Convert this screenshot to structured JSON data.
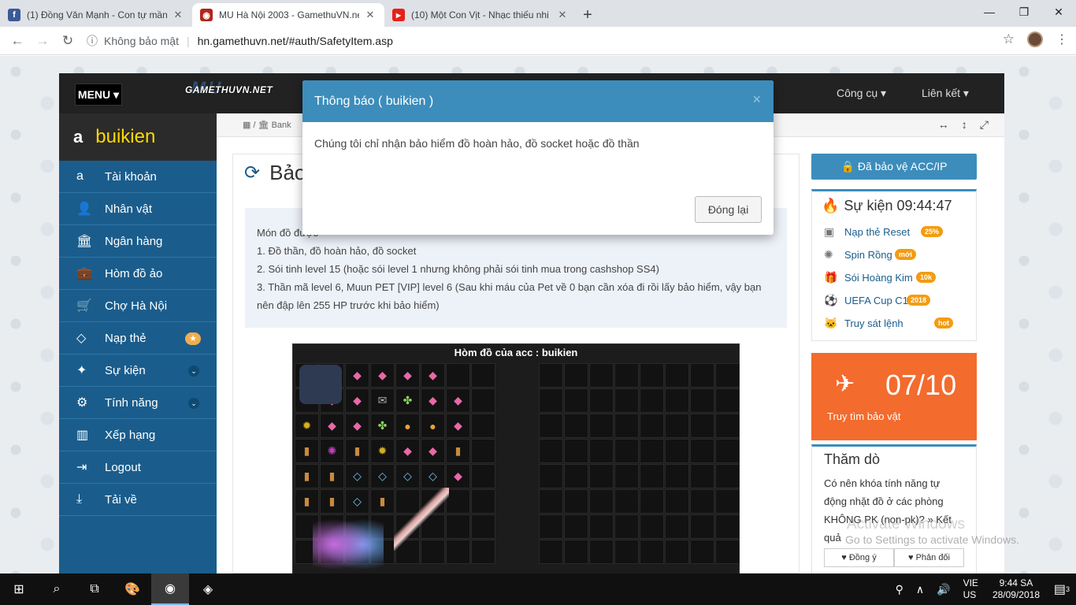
{
  "browser": {
    "tabs": [
      {
        "title": "(1) Đồng Văn Mạnh - Con tự mần",
        "icon": "facebook-icon",
        "color": "#3b5998",
        "glyph": "f"
      },
      {
        "title": "MU Hà Nội 2003 - GamethuVN.net",
        "icon": "mu-game-icon",
        "color": "#b0261c",
        "glyph": "◉"
      },
      {
        "title": "(10) Một Con Vịt - Nhạc thiếu nhi",
        "icon": "youtube-icon",
        "color": "#e62117",
        "glyph": "▶"
      }
    ],
    "security": "Không bảo mật",
    "url": "hn.gamethuvn.net/#auth/SafetyItem.asp"
  },
  "site": {
    "menu_label": "MENU ▾",
    "logo_back": "MU",
    "logo_text": "GAMETHUVN.NET",
    "nav_tools": "Công cụ ▾",
    "nav_links": "Liên kết ▾",
    "breadcrumb": "▦ /  🏛 Bank"
  },
  "user": {
    "name": "buikien"
  },
  "sidebar": {
    "items": [
      {
        "label": "Tài khoản",
        "icon": "a"
      },
      {
        "label": "Nhân vật",
        "icon": "👤"
      },
      {
        "label": "Ngân hàng",
        "icon": "🏛"
      },
      {
        "label": "Hòm đồ ảo",
        "icon": "💼"
      },
      {
        "label": "Chợ Hà Nội",
        "icon": "🛒"
      },
      {
        "label": "Nạp thẻ",
        "icon": "◇"
      },
      {
        "label": "Sự kiện",
        "icon": "✦"
      },
      {
        "label": "Tính năng",
        "icon": "⚙"
      },
      {
        "label": "Xếp hạng",
        "icon": "▥"
      },
      {
        "label": "Logout",
        "icon": "⇥"
      },
      {
        "label": "Tải về",
        "icon": "⤓"
      }
    ]
  },
  "main": {
    "title": "Bảo",
    "info_line0": "Món đồ được",
    "info_line1": "1. Đồ thần, đồ hoàn hảo, đồ socket",
    "info_line2": "2. Sói tinh level 15 (hoặc sói level 1 nhưng không phải sói tinh mua trong cashshop SS4)",
    "info_line3": "3. Thần mã level 6, Muun PET [VIP] level 6 (Sau khi máu của Pet về 0 bạn cần xóa đi rồi lấy bảo hiểm, vậy bạn nên đập lên 255 HP trước khi bảo hiểm)",
    "inventory_title": "Hòm đồ của acc : buikien"
  },
  "right": {
    "protect_label": "🔒 Đã bảo vệ ACC/IP",
    "event_title": "Sự kiện 09:44:47",
    "events": [
      {
        "label": "Nạp thẻ Reset",
        "badge": "25%",
        "icon": "card-icon",
        "glyph": "▣"
      },
      {
        "label": "Spin Rồng",
        "badge": "mới",
        "icon": "spinner-icon",
        "glyph": "✺"
      },
      {
        "label": "Sói Hoàng Kim",
        "badge": "10k",
        "icon": "gift-icon",
        "glyph": "🎁"
      },
      {
        "label": "UEFA Cup C1",
        "badge": "2018",
        "icon": "soccer-ball-icon",
        "glyph": "⚽"
      },
      {
        "label": "Truy sát lệnh",
        "badge": "hot",
        "icon": "github-cat-icon",
        "glyph": "🐱"
      }
    ],
    "treasure_count": "07/10",
    "treasure_label": "Truy tìm bảo vật",
    "poll_title": "Thăm dò",
    "poll_question": "Có nên khóa tính năng tự động nhặt đồ ở các phòng KHÔNG PK (non-pk)? » Kết quả",
    "poll_yes": "♥ Đồng ý",
    "poll_no": "♥ Phản đối"
  },
  "modal": {
    "title": "Thông báo ( buikien )",
    "message": "Chúng tôi chỉ nhận bảo hiểm đồ hoàn hảo, đồ socket hoặc đồ thần",
    "close_button": "Đóng lại"
  },
  "watermark": {
    "line1": "Activate Windows",
    "line2": "Go to Settings to activate Windows."
  },
  "taskbar": {
    "lang_top": "VIE",
    "lang_bottom": "US",
    "time": "9:44 SA",
    "date": "28/09/2018",
    "notifications": "3"
  }
}
